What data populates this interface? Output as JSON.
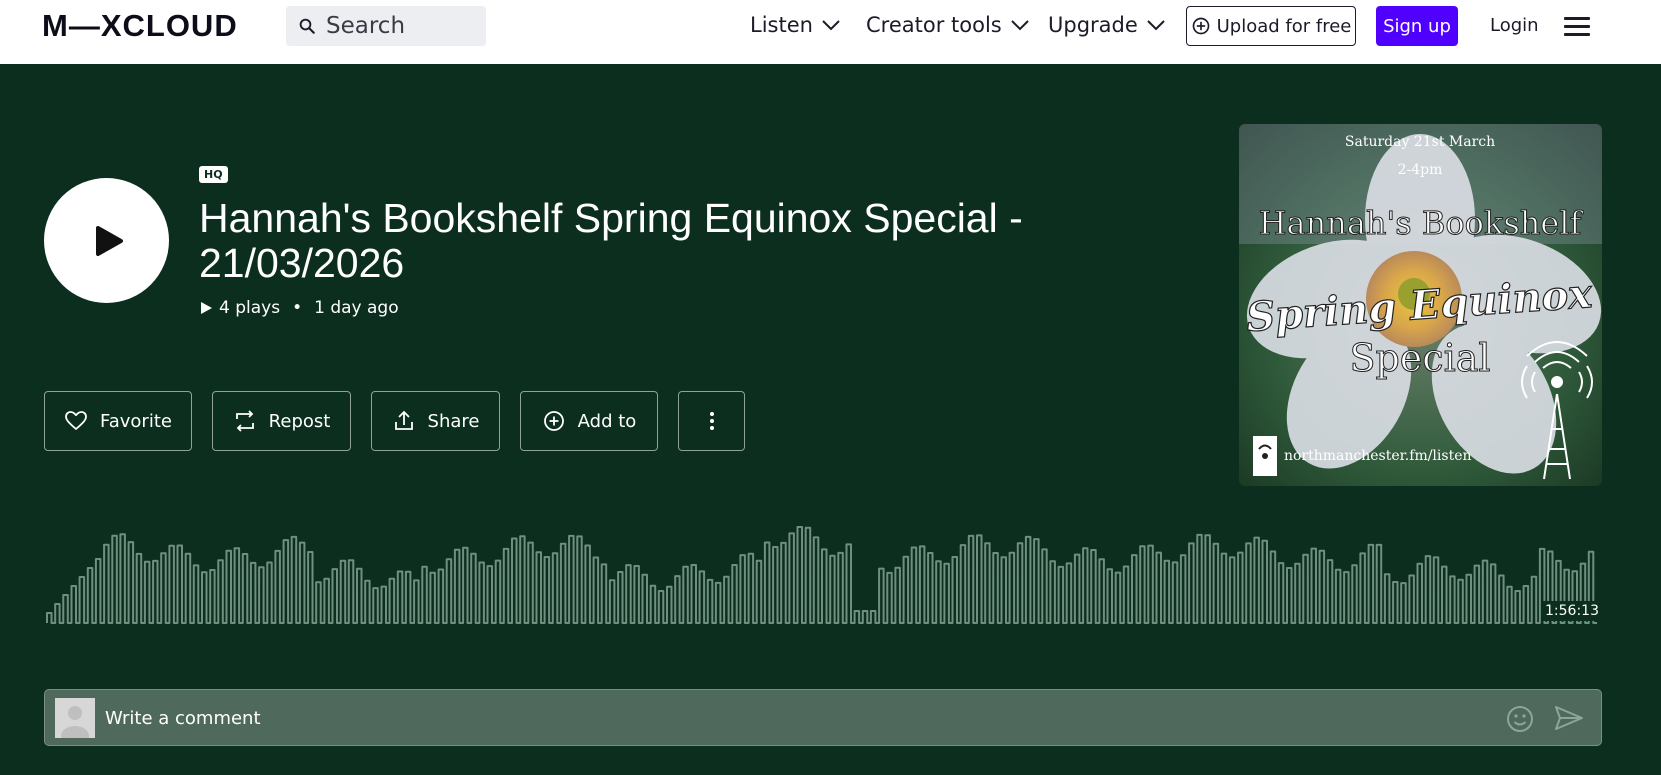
{
  "nav": {
    "logo": "M—XCLOUD",
    "search_placeholder": "Search",
    "links": [
      "Listen",
      "Creator tools",
      "Upgrade"
    ],
    "upload_label": "Upload for free",
    "signup_label": "Sign up",
    "login_label": "Login"
  },
  "show": {
    "quality_badge": "HQ",
    "title": "Hannah's Bookshelf Spring Equinox Special - 21/03/2026",
    "plays": "4 plays",
    "age": "1 day ago",
    "duration": "1:56:13"
  },
  "actions": {
    "favorite": "Favorite",
    "repost": "Repost",
    "share": "Share",
    "add_to": "Add to"
  },
  "artwork": {
    "date_line": "Saturday 21st March",
    "time_line": "2-4pm",
    "name_line": "Hannah's Bookshelf",
    "theme_line": "Spring Equinox",
    "special_line": "Special",
    "url_line": "northmanchester.fm/listen"
  },
  "comment": {
    "placeholder": "Write a comment"
  },
  "colors": {
    "background": "#0c2e1f",
    "accent": "#5000ff",
    "waveform": "#6f8f7f"
  }
}
